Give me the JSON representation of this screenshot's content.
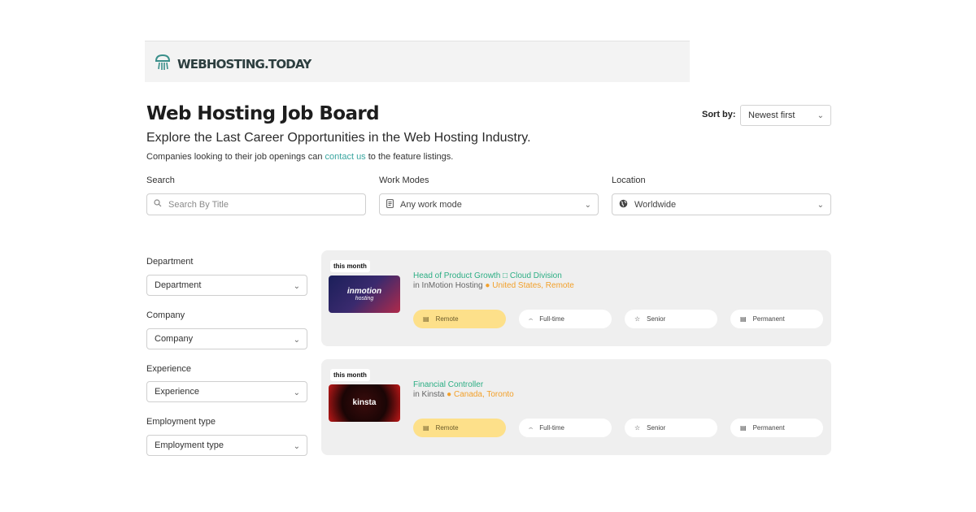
{
  "header": {
    "logo_text": "WEBHOSTING.TODAY",
    "logo_icon": "cloud-jellyfish-icon"
  },
  "page": {
    "title": "Web Hosting Job Board",
    "subtitle": "Explore the Last Career Opportunities in the Web Hosting Industry.",
    "note_before": "Companies looking to their job openings can",
    "note_link": "contact us",
    "note_after": "to the feature listings."
  },
  "sort": {
    "label": "Sort by:",
    "value": "Newest first"
  },
  "filters": {
    "search": {
      "label": "Search",
      "placeholder": "Search By Title",
      "value": ""
    },
    "work_modes": {
      "label": "Work Modes",
      "value": "Any work mode"
    },
    "location": {
      "label": "Location",
      "value": "Worldwide"
    }
  },
  "sidebar": [
    {
      "label": "Department",
      "value": "Department"
    },
    {
      "label": "Company",
      "value": "Company"
    },
    {
      "label": "Experience",
      "value": "Experience"
    },
    {
      "label": "Employment type",
      "value": "Employment type"
    }
  ],
  "jobs": [
    {
      "badge": "this month",
      "logo_text": "inmotion",
      "logo_sub": "hosting",
      "title": "Head of Product Growth □ Cloud Division",
      "company_prefix": "in InMotion Hosting",
      "location": "United States, Remote",
      "tags": [
        "Remote",
        "Full-time",
        "Senior",
        "Permanent"
      ]
    },
    {
      "badge": "this month",
      "logo_text": "kinsta",
      "logo_sub": "",
      "title": "Financial Controller",
      "company_prefix": "in Kinsta",
      "location": "Canada, Toronto",
      "tags": [
        "Remote",
        "Full-time",
        "Senior",
        "Permanent"
      ]
    }
  ],
  "colors": {
    "accent_green": "#2cae84",
    "link_teal": "#3aa6a0",
    "location_orange": "#f2a02a",
    "active_tag": "#fde08a"
  }
}
